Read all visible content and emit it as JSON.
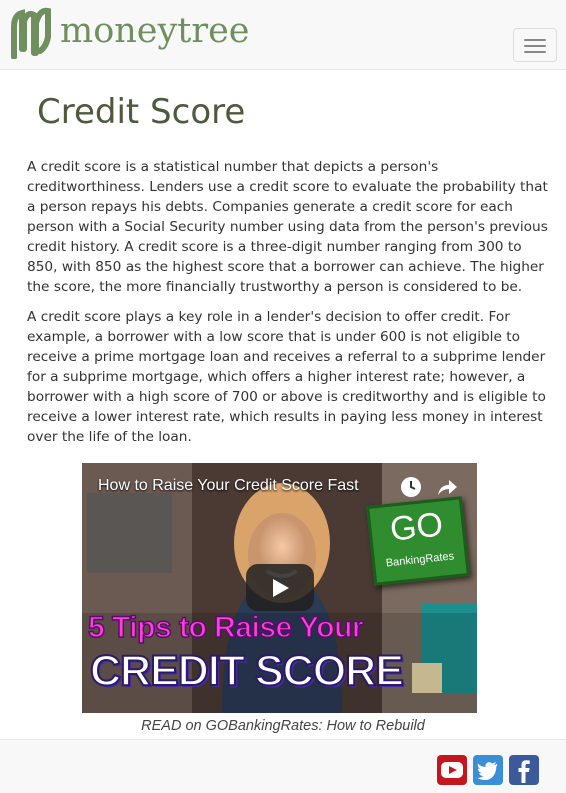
{
  "header": {
    "logo_text": "moneytree",
    "menu_icon": "hamburger-icon"
  },
  "page": {
    "title": "Credit Score",
    "paragraphs": [
      "A credit score is a statistical number that depicts a person's creditworthiness. Lenders use a credit score to evaluate the probability that a person repays his debts. Companies generate a credit score for each person with a Social Security number using data from the person's previous credit history. A credit score is a three-digit number ranging from 300 to 850, with 850 as the highest score that a borrower can achieve. The higher the score, the more financially trustworthy a person is considered to be.",
      "A credit score plays a key role in a lender's decision to offer credit. For example, a borrower with a low score that is under 600 is not eligible to receive a prime mortgage loan and receives a referral to a subprime lender for a subprime mortgage, which offers a higher interest rate; however, a borrower with a high score of 700 or above is creditworthy and is eligible to receive a lower interest rate, which results in paying less money in interest over the life of the loan."
    ]
  },
  "video": {
    "title": "How to Raise Your Credit Score Fast",
    "badge_big": "GO",
    "badge_small": "BankingRates",
    "overlay_line1": "5 Tips to Raise Your",
    "overlay_line2": "CREDIT SCORE",
    "icons": [
      "clock-icon",
      "share-icon",
      "play-icon"
    ]
  },
  "caption": "READ on GOBankingRates: How to Rebuild",
  "footer": {
    "social": [
      "youtube-icon",
      "twitter-icon",
      "facebook-icon"
    ]
  },
  "colors": {
    "brand_green": "#6f8f5e",
    "title_color": "#4e5a3c",
    "youtube_red": "#c4171d",
    "twitter_blue": "#3b8fd6",
    "facebook_blue": "#3c5a9a"
  }
}
